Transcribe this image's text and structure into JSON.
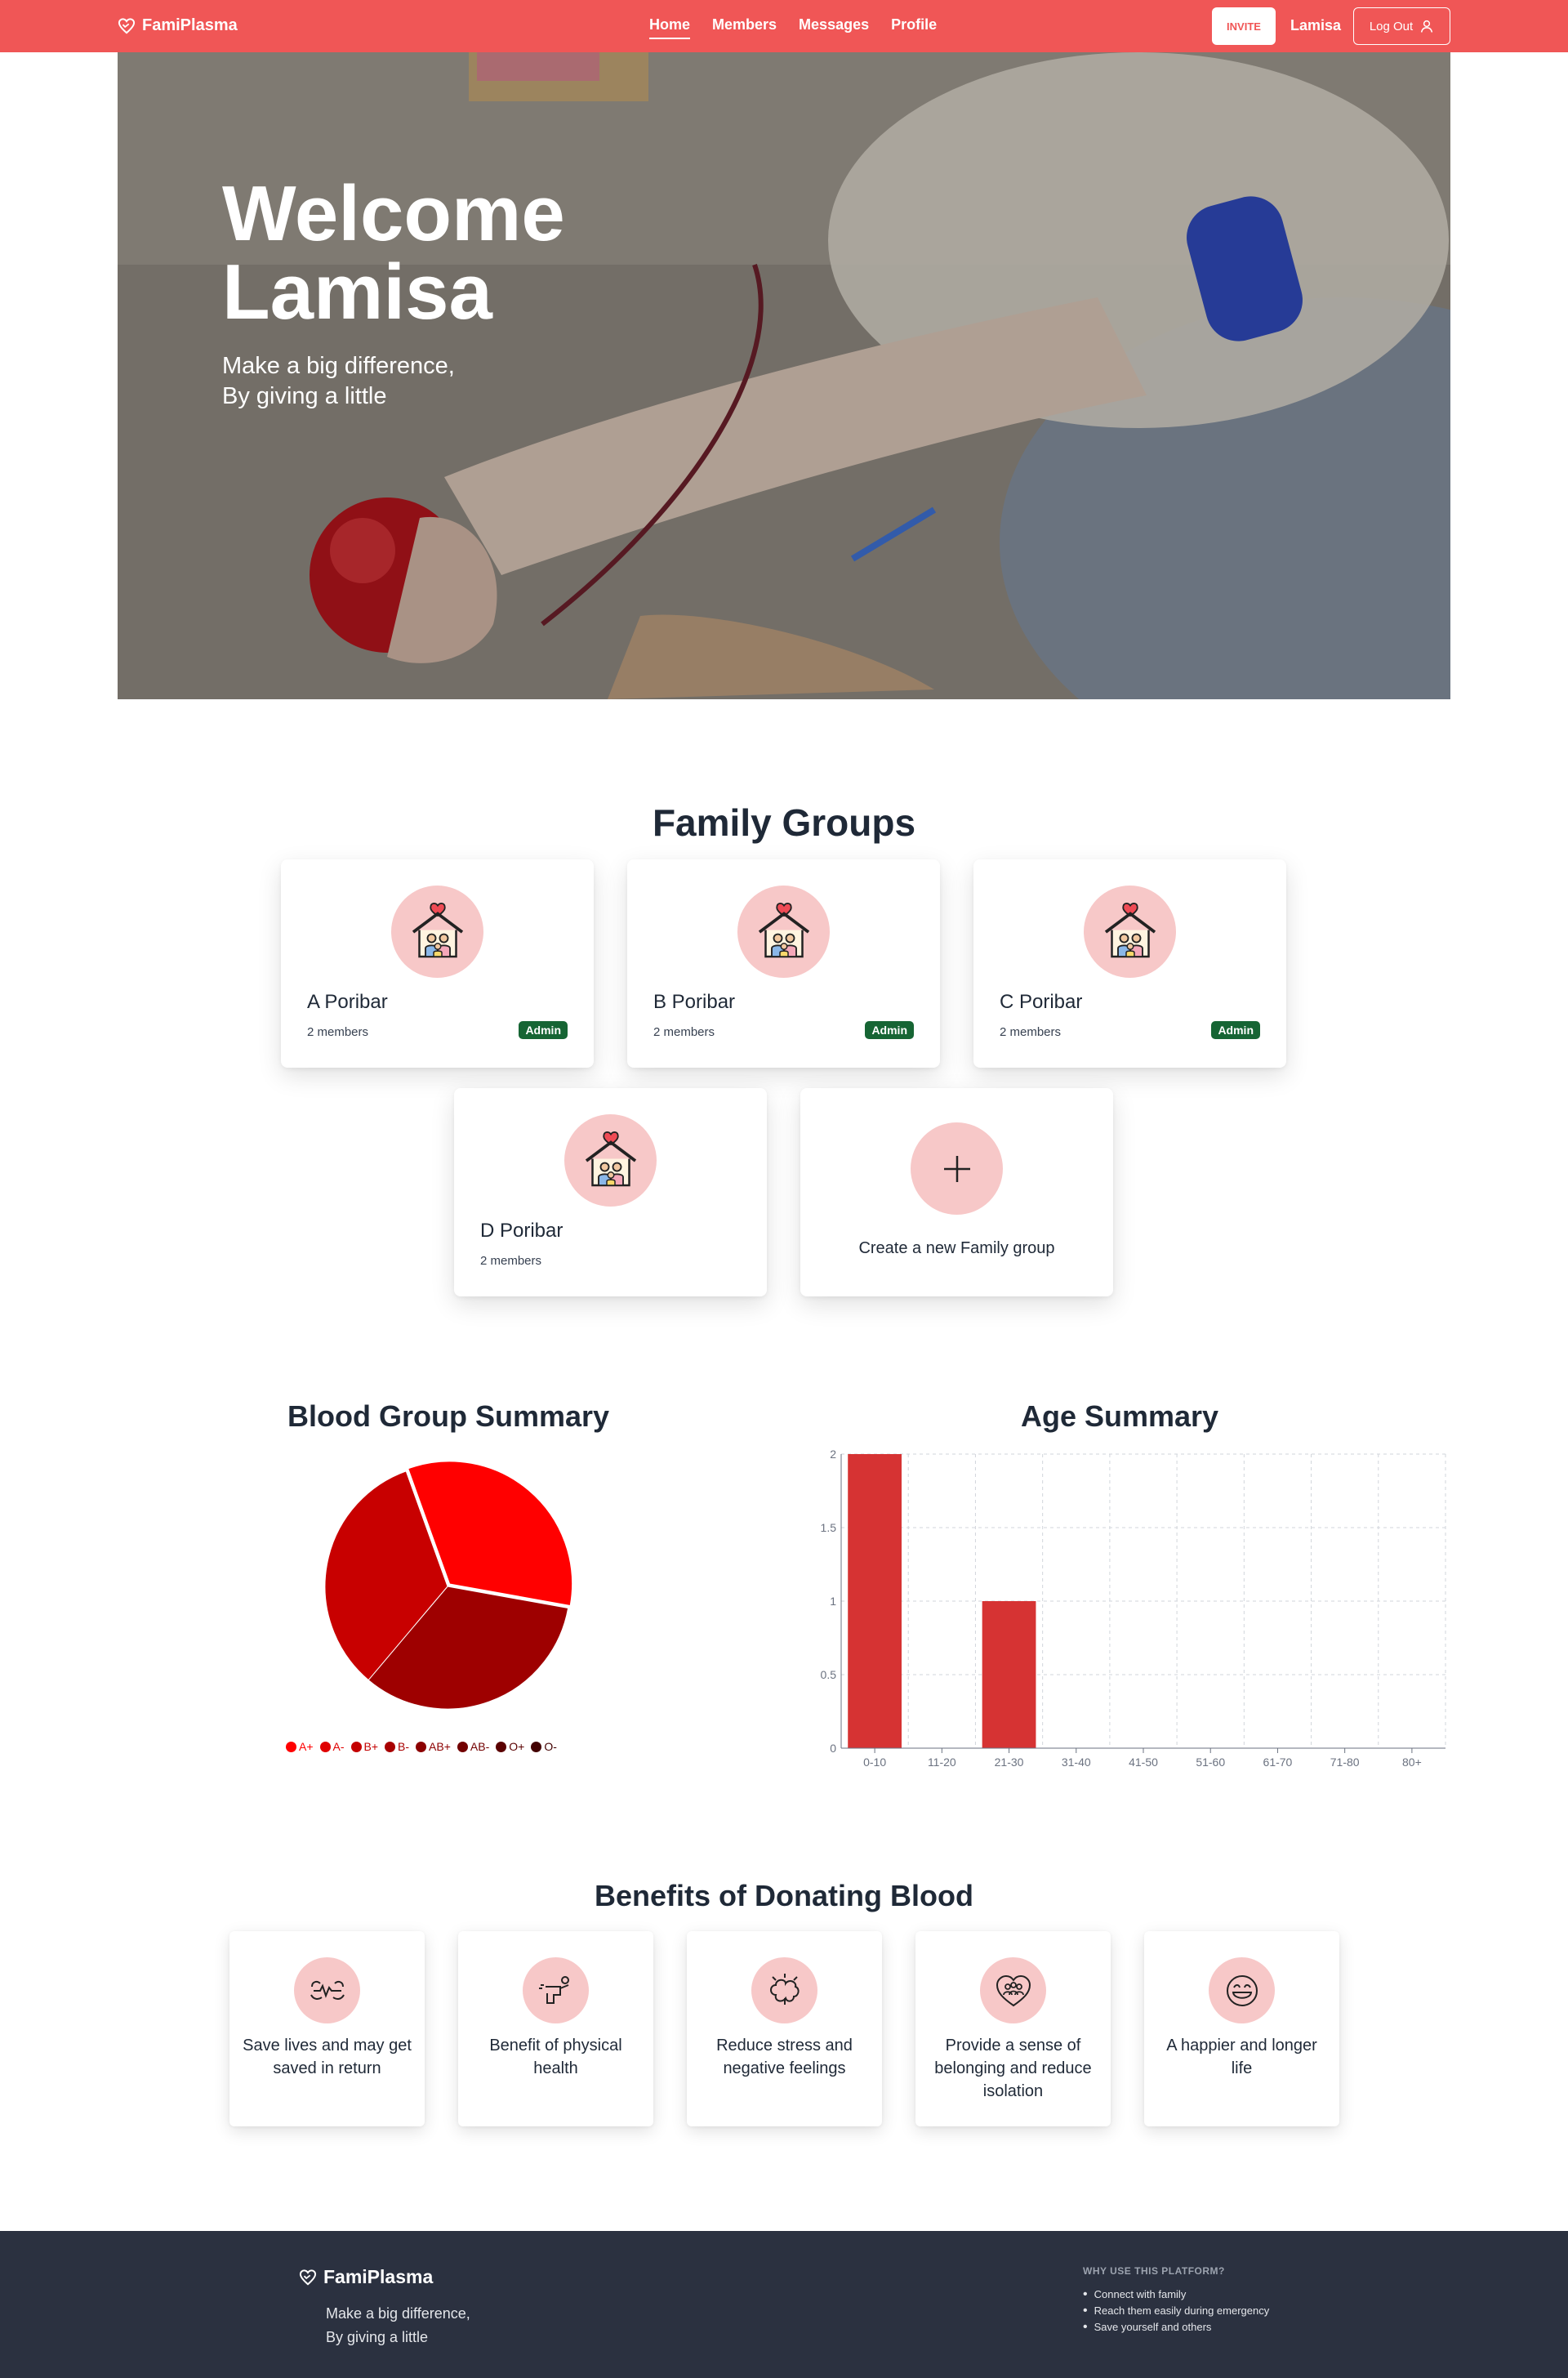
{
  "navbar": {
    "brand": "FamiPlasma",
    "links": [
      {
        "label": "Home",
        "active": true
      },
      {
        "label": "Members",
        "active": false
      },
      {
        "label": "Messages",
        "active": false
      },
      {
        "label": "Profile",
        "active": false
      }
    ],
    "invite_label": "INVITE",
    "user_name": "Lamisa",
    "logout_label": "Log Out",
    "background_color": "#f05656"
  },
  "hero": {
    "title_line1": "Welcome",
    "title_line2": "Lamisa",
    "subtitle_line1": "Make a big difference,",
    "subtitle_line2": "By giving a little"
  },
  "family_groups": {
    "title": "Family Groups",
    "groups": [
      {
        "name": "A Poribar",
        "members": "2 members",
        "badge": "Admin"
      },
      {
        "name": "B Poribar",
        "members": "2 members",
        "badge": "Admin"
      },
      {
        "name": "C Poribar",
        "members": "2 members",
        "badge": "Admin"
      },
      {
        "name": "D Poribar",
        "members": "2 members",
        "badge": ""
      }
    ],
    "create_label": "Create a new Family group",
    "icon": "family-house-heart-icon"
  },
  "blood_group_summary": {
    "title": "Blood Group Summary"
  },
  "age_summary": {
    "title": "Age Summary"
  },
  "chart_data": [
    {
      "type": "pie",
      "title": "Blood Group Summary",
      "categories": [
        "A+",
        "A-",
        "B+",
        "B-",
        "AB+",
        "AB-",
        "O+",
        "O-"
      ],
      "values": [
        1,
        0,
        0,
        0,
        1,
        0,
        0,
        0
      ],
      "extra_slices": [
        1
      ],
      "colors": [
        "#ff0000",
        "#e00000",
        "#c40000",
        "#a80000",
        "#8c0000",
        "#720000",
        "#5a0000",
        "#420000"
      ],
      "legend_position": "bottom"
    },
    {
      "type": "bar",
      "title": "Age Summary",
      "categories": [
        "0-10",
        "11-20",
        "21-30",
        "31-40",
        "41-50",
        "51-60",
        "61-70",
        "71-80",
        "80+"
      ],
      "values": [
        2,
        0,
        1,
        0,
        0,
        0,
        0,
        0,
        0
      ],
      "ylim": [
        0,
        2
      ],
      "yticks": [
        "0",
        "0.5",
        "1",
        "1.5",
        "2"
      ],
      "bar_color": "#d63333",
      "grid": true
    }
  ],
  "benefits": {
    "title": "Benefits of Donating Blood",
    "items": [
      {
        "text": "Save lives and may get saved in return",
        "icon": "heartbeat-hands-icon"
      },
      {
        "text": "Benefit of physical health",
        "icon": "strong-arm-icon"
      },
      {
        "text": "Reduce stress and negative feelings",
        "icon": "brain-stress-icon"
      },
      {
        "text": "Provide a sense of belonging and reduce isolation",
        "icon": "heart-people-icon"
      },
      {
        "text": "A happier and longer life",
        "icon": "happy-face-icon"
      }
    ]
  },
  "footer": {
    "brand": "FamiPlasma",
    "tagline_line1": "Make a big difference,",
    "tagline_line2": "By giving a little",
    "why_heading": "WHY USE THIS PLATFORM?",
    "why_items": [
      "Connect with family",
      "Reach them easily during emergency",
      "Save yourself and others"
    ]
  }
}
